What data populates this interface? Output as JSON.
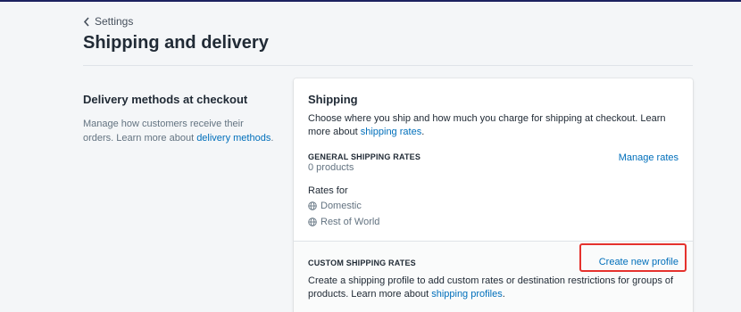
{
  "breadcrumb": {
    "label": "Settings"
  },
  "page": {
    "title": "Shipping and delivery"
  },
  "delivery_section": {
    "heading": "Delivery methods at checkout",
    "description": "Manage how customers receive their orders. Learn more about ",
    "link": "delivery methods",
    "after_link": "."
  },
  "shipping_card": {
    "title": "Shipping",
    "description": "Choose where you ship and how much you charge for shipping at checkout. Learn more about ",
    "link": "shipping rates",
    "after_link": ".",
    "general": {
      "heading": "GENERAL SHIPPING RATES",
      "products": "0 products",
      "manage_label": "Manage rates",
      "rates_for": "Rates for",
      "zones": [
        {
          "name": "Domestic",
          "icon": "globe-icon"
        },
        {
          "name": "Rest of World",
          "icon": "globe-icon"
        }
      ]
    },
    "custom": {
      "heading": "CUSTOM SHIPPING RATES",
      "create_label": "Create new profile",
      "description": "Create a shipping profile to add custom rates or destination restrictions for groups of products. Learn more about ",
      "link": "shipping profiles",
      "after_link": "."
    }
  },
  "colors": {
    "link": "#006fbb",
    "highlight": "#e5322d",
    "background": "#f4f6f8"
  }
}
